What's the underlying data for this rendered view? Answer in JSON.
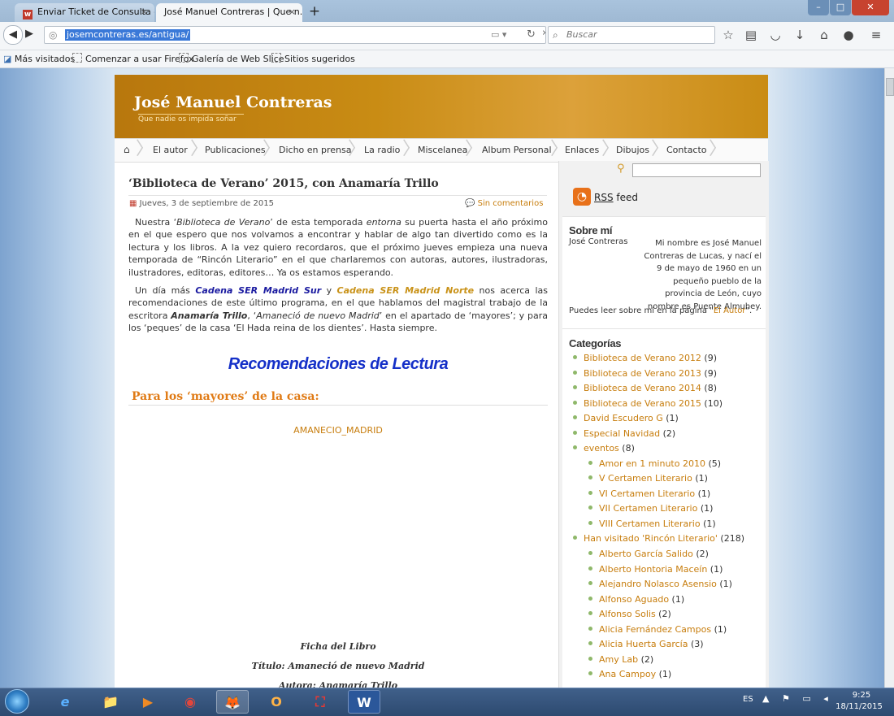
{
  "browser": {
    "tabs": [
      {
        "label": "Enviar Ticket de Consulta -...",
        "close": "×"
      },
      {
        "label": "José Manuel Contreras | Que n...",
        "close": "×"
      }
    ],
    "new_tab": "+",
    "window_controls": {
      "minimize": "–",
      "maximize": "□",
      "close": "✕"
    },
    "url": "josemcontreras.es/antigua/",
    "search_placeholder": "Buscar",
    "bookmarks": [
      "Más visitados",
      "Comenzar a usar Firefox",
      "Galería de Web Slice",
      "Sitios sugeridos"
    ]
  },
  "site": {
    "title": "José Manuel Contreras",
    "subtitle": "Que nadie os impida soñar",
    "menu": [
      "El autor",
      "Publicaciones",
      "Dicho en prensa",
      "La radio",
      "Miscelanea",
      "Album Personal",
      "Enlaces",
      "Dibujos",
      "Contacto"
    ]
  },
  "post": {
    "title": "‘Biblioteca de Verano’ 2015, con Anamaría Trillo",
    "date": "Jueves, 3 de septiembre de 2015",
    "comments": "Sin comentarios",
    "p1": {
      "a": "Nuestra ‘",
      "b": "Biblioteca de Verano",
      "c": "’ de esta temporada ",
      "d": "entorna",
      "e": " su puerta hasta el año próximo en el que espero que nos volvamos a encontrar y hablar de algo tan divertido como es la lectura y los libros. A la vez quiero recordaros, que el próximo jueves empieza una nueva temporada de “Rincón Literario” en el que charlaremos con autoras, autores, ilustradoras, ilustradores, editoras, editores… Ya os estamos esperando."
    },
    "p2": {
      "a": "Un día más ",
      "b": "Cadena SER Madrid Sur",
      "c": " y ",
      "d": "Cadena SER Madrid Norte",
      "e": " nos acerca las recomendaciones de este último programa, en el que hablamos del magistral trabajo de la escritora ",
      "f": "Anamaría Trillo",
      "g": ", ‘",
      "h": "Amaneció de nuevo Madrid",
      "i": "’ en el apartado de ‘mayores’; y para los ‘peques’ de la casa ‘El Hada reina de los dientes’. Hasta siempre."
    },
    "recomendaciones": "Recomendaciones de Lectura",
    "section_mayores": "Para los ‘mayores’ de la casa:",
    "image_alt": "AMANECIO_MADRID",
    "ficha": [
      "Ficha del Libro",
      "Título: Amaneció de nuevo Madrid",
      "Autora: Anamaría Trillo"
    ]
  },
  "sidebar": {
    "rss_prefix": "RSS",
    "rss_suffix": " feed",
    "about_heading": "Sobre mí",
    "about_name": "José Contreras",
    "about_text": "Mi nombre es José Manuel Contreras de Lucas, y nací el 9 de mayo de 1960 en un pequeño pueblo de la provincia de León, cuyo nombre es Puente Almuhey.",
    "about_more_prefix": "Puedes leer sobre mí en la página \"",
    "about_more_link": "El Autor",
    "about_more_suffix": "\".",
    "categories_heading": "Categorías",
    "categories": [
      {
        "label": "Biblioteca de Verano 2012",
        "count": " (9)"
      },
      {
        "label": "Biblioteca de Verano 2013",
        "count": " (9)"
      },
      {
        "label": "Biblioteca de Verano 2014",
        "count": " (8)"
      },
      {
        "label": "Biblioteca de Verano 2015",
        "count": " (10)"
      },
      {
        "label": "David Escudero G",
        "count": " (1)"
      },
      {
        "label": "Especial Navidad",
        "count": " (2)"
      },
      {
        "label": "eventos",
        "count": " (8)"
      },
      {
        "label": "Amor en 1 minuto 2010",
        "count": " (5)"
      },
      {
        "label": "V Certamen Literario",
        "count": " (1)"
      },
      {
        "label": "VI Certamen Literario",
        "count": " (1)"
      },
      {
        "label": "VII Certamen Literario",
        "count": " (1)"
      },
      {
        "label": "VIII Certamen Literario",
        "count": " (1)"
      },
      {
        "label": "Han visitado 'Rincón Literario'",
        "count": " (218)"
      },
      {
        "label": "Alberto García Salido",
        "count": " (2)"
      },
      {
        "label": "Alberto Hontoria Maceín",
        "count": " (1)"
      },
      {
        "label": "Alejandro Nolasco Asensio",
        "count": " (1)"
      },
      {
        "label": "Alfonso Aguado",
        "count": " (1)"
      },
      {
        "label": "Alfonso Solis",
        "count": " (2)"
      },
      {
        "label": "Alicia Fernández Campos",
        "count": " (1)"
      },
      {
        "label": "Alicia Huerta García",
        "count": " (3)"
      },
      {
        "label": "Amy Lab",
        "count": " (2)"
      },
      {
        "label": "Ana Campoy",
        "count": " (1)"
      }
    ]
  },
  "taskbar": {
    "apps": [
      "e",
      "📁",
      "▶",
      "◉",
      "🦊",
      "O",
      "⛶",
      "W"
    ],
    "lang": "ES",
    "time": "9:25",
    "date": "18/11/2015"
  }
}
